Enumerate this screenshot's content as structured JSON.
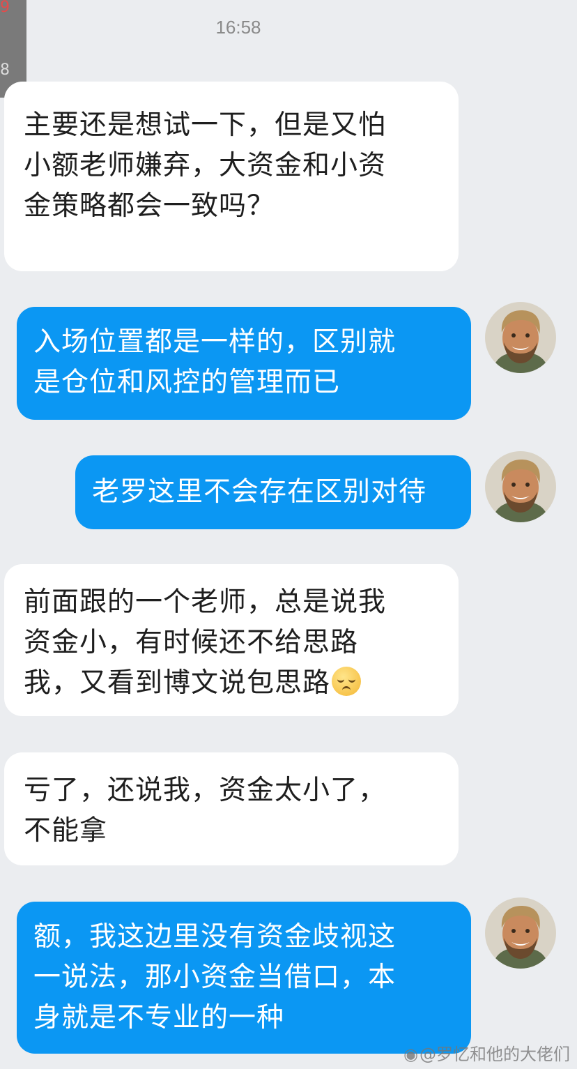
{
  "status": {
    "time": "16:58"
  },
  "partial_avatar": {
    "badge_fragment": "9",
    "number_fragment": "8"
  },
  "messages": [
    {
      "side": "incoming",
      "text": "主要还是想试一下，但是又怕\n小额老师嫌弃，大资金和小资\n金策略都会一致吗？"
    },
    {
      "side": "outgoing",
      "text": "入场位置都是一样的，区别就\n是仓位和风控的管理而已"
    },
    {
      "side": "outgoing",
      "text": "老罗这里不会存在区别对待"
    },
    {
      "side": "incoming",
      "text": "前面跟的一个老师，总是说我\n资金小，有时候还不给思路\n我，又看到博文说包思路",
      "emoji": "pensive-face-emoji"
    },
    {
      "side": "incoming",
      "text": "亏了，还说我，资金太小了，\n不能拿"
    },
    {
      "side": "outgoing",
      "text": "额，我这边里没有资金歧视这\n一说法，那小资金当借口，本\n身就是不专业的一种"
    }
  ],
  "avatar": {
    "description_icon": "smiling-bearded-man-avatar"
  },
  "watermark": {
    "icon": "weibo-icon",
    "text": "@罗忆和他的大佬们"
  },
  "colors": {
    "background": "#ebedf0",
    "incoming_bubble": "#ffffff",
    "outgoing_bubble": "#0b97f3",
    "outgoing_text": "#ffffff"
  }
}
